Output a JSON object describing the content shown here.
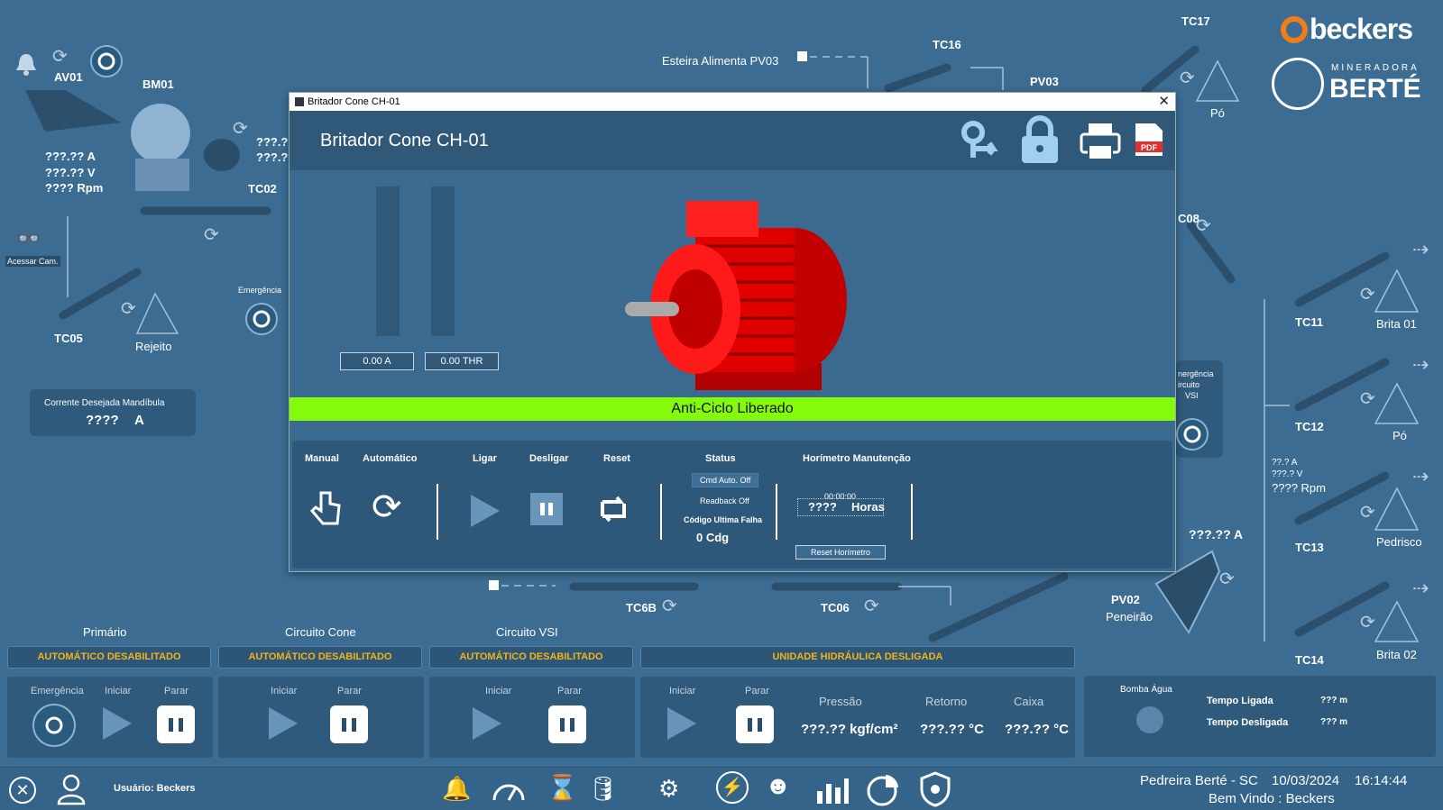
{
  "top": {
    "esteira_label": "Esteira Alimenta PV03",
    "tc16": "TC16",
    "tc17": "TC17",
    "pv03": "PV03",
    "po_top": "Pó",
    "av01": "AV01",
    "bm01": "BM01",
    "tc02": "TC02",
    "bm_amps": "???.?? A",
    "bm_volts": "???.?? V",
    "bm_rpm": "???? Rpm",
    "bm_partial_1": "???.?",
    "bm_partial_2": "???.?",
    "acessar_cam": "Acessar Cam.",
    "emergencia": "Emergência",
    "tc05": "TC05",
    "rejeito": "Rejeito",
    "corrente_title": "Corrente Desejada Mandíbula",
    "corrente_value": "????",
    "corrente_unit": "A"
  },
  "right": {
    "tc08": "C08",
    "emerg_vsi_1": "nergência",
    "emerg_vsi_2": "ircuito",
    "emerg_vsi_3": "VSI",
    "tc11": "TC11",
    "brita01": "Brita 01",
    "tc12": "TC12",
    "po2": "Pó",
    "tc13_a": "??.? A",
    "tc13_v": "???.? V",
    "tc13_rpm": "???? Rpm",
    "tc13": "TC13",
    "pedrisco": "Pedrisco",
    "pv02_amps": "???.?? A",
    "pv02": "PV02",
    "peneirao": "Peneirão",
    "tc14": "TC14",
    "brita02": "Brita 02"
  },
  "middle": {
    "tc6b": "TC6B",
    "tc06": "TC06"
  },
  "logos": {
    "beckers": "beckers",
    "mineradora": "MINERADORA",
    "berte": "BERTÉ"
  },
  "dialog": {
    "titlebar": "Britador Cone CH-01",
    "title": "Britador Cone CH-01",
    "meter_a": "0.00 A",
    "meter_thr": "0.00 THR",
    "banner": "Anti-Ciclo Liberado",
    "headers": {
      "manual": "Manual",
      "automatico": "Automático",
      "ligar": "Ligar",
      "desligar": "Desligar",
      "reset": "Reset",
      "status": "Status",
      "horimetro": "Horímetro Manutenção"
    },
    "status": {
      "cmd": "Cmd Auto. Off",
      "readback": "Readback Off",
      "codigo_label": "Código Ultima Falha",
      "codigo_value": "0 Cdg"
    },
    "horimetro": {
      "time": "00:00:00",
      "value": "????",
      "unit": "Horas",
      "reset_label": "Reset Horímetro"
    }
  },
  "bottom": {
    "sections": {
      "primario": "Primário",
      "cone": "Circuito Cone",
      "vsi": "Circuito VSI"
    },
    "statuses": {
      "s1": "AUTOMÁTICO DESABILITADO",
      "s2": "AUTOMÁTICO DESABILITADO",
      "s3": "AUTOMÁTICO DESABILITADO",
      "s4": "UNIDADE HIDRÁULICA DESLIGADA"
    },
    "labels": {
      "emergencia": "Emergência",
      "iniciar": "Iniciar",
      "parar": "Parar"
    },
    "hidraulica": {
      "pressao_label": "Pressão",
      "pressao_value": "???.?? kgf/cm²",
      "retorno_label": "Retorno",
      "retorno_value": "???.?? °C",
      "caixa_label": "Caixa",
      "caixa_value": "???.?? °C"
    },
    "bomba": {
      "title": "Bomba Água",
      "ligada_label": "Tempo Ligada",
      "ligada_value": "??? m",
      "desligada_label": "Tempo Desligada",
      "desligada_value": "??? m"
    }
  },
  "taskbar": {
    "usuario": "Usuário: Beckers",
    "location": "Pedreira Berté - SC",
    "date": "10/03/2024",
    "time": "16:14:44",
    "welcome": "Bem Vindo : Beckers"
  },
  "colors": {
    "background": "#3c6c92",
    "banner": "#84fb0a",
    "status_text": "#f0b419"
  }
}
